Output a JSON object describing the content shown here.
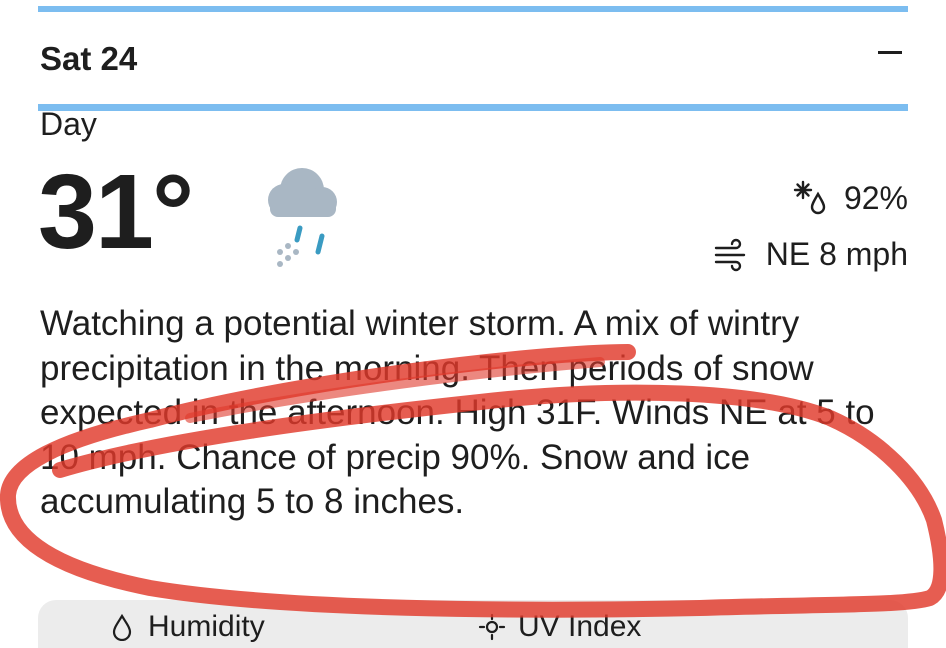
{
  "day": {
    "title": "Sat 24",
    "collapse_label": "−"
  },
  "period": {
    "label": "Day",
    "temperature": "31°",
    "condition_icon": "cloud-wintry-mix-icon",
    "humidity_icon": "snow-precip-icon",
    "precip_chance": "92%",
    "wind_icon": "wind-icon",
    "wind": "NE 8 mph",
    "narrative": "Watching a potential winter storm. A mix of wintry precipitation in the morning. Then periods of snow expected in the afternoon. High 31F. Winds NE at 5 to 10 mph. Chance of precip 90%. Snow and ice accumulating 5 to 8 inches."
  },
  "details_card": {
    "items": [
      {
        "label": "Humidity",
        "icon": "humidity-icon"
      },
      {
        "label": "UV Index",
        "icon": "uv-index-icon"
      }
    ]
  },
  "colors": {
    "accent_rule": "#7cbdf0",
    "annotation_stroke": "#e0392b",
    "text": "#1e1e1e",
    "card_bg": "#ececec"
  }
}
